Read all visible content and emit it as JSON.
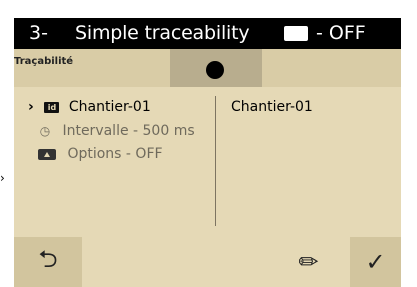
{
  "header": {
    "number": "3-",
    "title": "Simple traceability",
    "mode_icon": "options-icon",
    "mode_text": "- OFF"
  },
  "subbar": {
    "label": "Traçabilité"
  },
  "left_pane": {
    "item1": "Chantier-01",
    "item2": "Intervalle - 500 ms",
    "item3": "Options - OFF"
  },
  "right_pane": {
    "value": "Chantier-01"
  },
  "bottom": {
    "back_icon": "back-arrow-icon",
    "edit_icon": "pencil-icon",
    "ok_icon": "checkmark-icon"
  }
}
